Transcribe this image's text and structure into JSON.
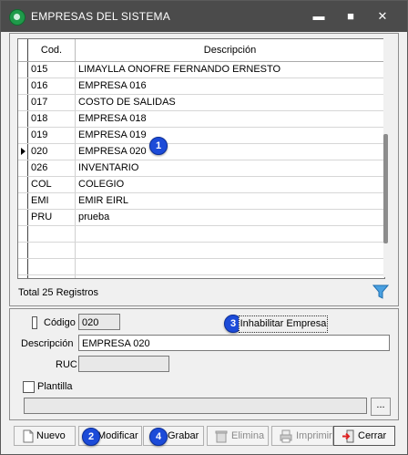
{
  "window": {
    "title": "EMPRESAS DEL SISTEMA",
    "minimize_glyph": "▬",
    "maximize_glyph": "■",
    "close_glyph": "✕"
  },
  "grid": {
    "columns": {
      "cod": "Cod.",
      "desc": "Descripción"
    },
    "rows": [
      {
        "cod": "015",
        "desc": "LIMAYLLA ONOFRE FERNANDO ERNESTO"
      },
      {
        "cod": "016",
        "desc": "EMPRESA 016"
      },
      {
        "cod": "017",
        "desc": "COSTO DE SALIDAS"
      },
      {
        "cod": "018",
        "desc": "EMPRESA 018"
      },
      {
        "cod": "019",
        "desc": "EMPRESA 019"
      },
      {
        "cod": "020",
        "desc": "EMPRESA 020"
      },
      {
        "cod": "026",
        "desc": "INVENTARIO"
      },
      {
        "cod": "COL",
        "desc": "COLEGIO"
      },
      {
        "cod": "EMI",
        "desc": "EMIR EIRL"
      },
      {
        "cod": "PRU",
        "desc": "prueba"
      },
      {
        "cod": "",
        "desc": ""
      },
      {
        "cod": "",
        "desc": ""
      },
      {
        "cod": "",
        "desc": ""
      },
      {
        "cod": "",
        "desc": ""
      }
    ],
    "current_row_index": 5,
    "total_label": "Total 25 Registros"
  },
  "form": {
    "codigo_label": "Código",
    "codigo_value": "020",
    "inhabilitar_label": "Inhabilitar Empresa",
    "descripcion_label": "Descripción",
    "descripcion_value": "EMPRESA 020",
    "ruc_label": "RUC",
    "ruc_value": "",
    "plantilla_label": "Plantilla",
    "plantilla_value": "",
    "ellipsis_label": "..."
  },
  "toolbar": {
    "nuevo": "Nuevo",
    "modificar": "Modificar",
    "grabar": "Grabar",
    "elimina": "Elimina",
    "imprimir": "Imprimir",
    "cerrar": "Cerrar"
  },
  "callouts": {
    "one": "1",
    "two": "2",
    "three": "3",
    "four": "4"
  },
  "colors": {
    "titlebar": "#4b4b4b",
    "callout": "#1c4bd8",
    "app_icon": "#1f9a4a"
  }
}
